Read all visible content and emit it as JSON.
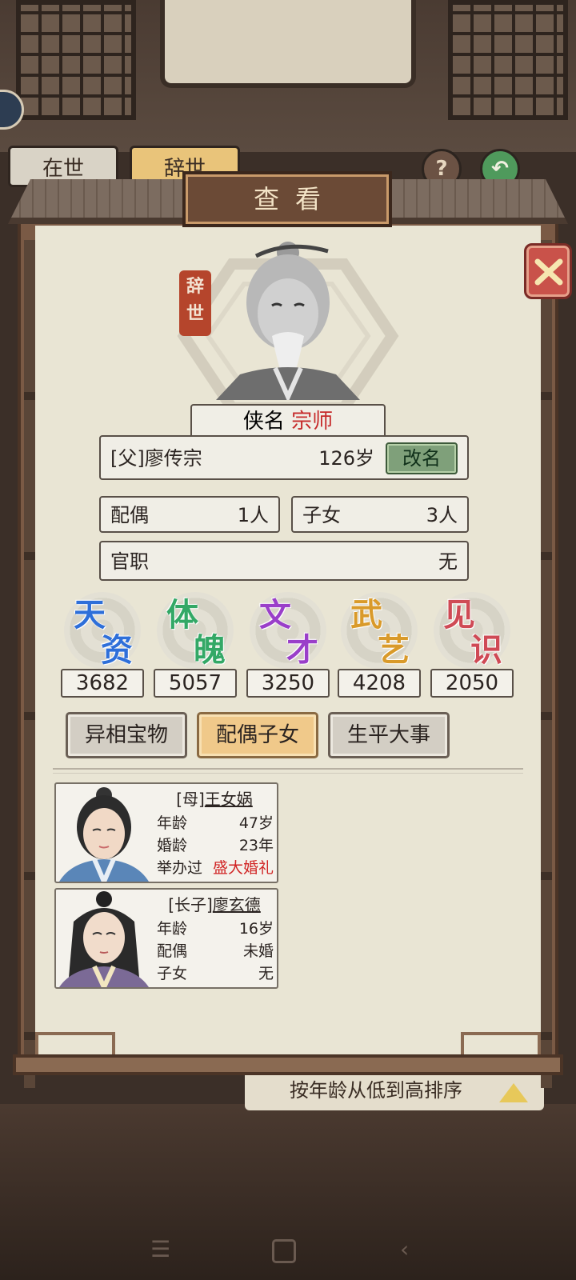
{
  "background": {
    "tabs": [
      "在世",
      "辞世"
    ],
    "sort_label": "按年龄从低到高排序"
  },
  "modal": {
    "title": "查看",
    "status_seal": [
      "辞",
      "世"
    ],
    "hero_title_label": "侠名",
    "hero_title_value": "宗师",
    "name": "[父]廖传宗",
    "age": "126岁",
    "rename_button": "改名",
    "spouse_label": "配偶",
    "spouse_value": "1人",
    "children_label": "子女",
    "children_value": "3人",
    "office_label": "官职",
    "office_value": "无",
    "stats": [
      {
        "c1": "天",
        "c2": "资",
        "value": "3682",
        "color": "#2e6fd9"
      },
      {
        "c1": "体",
        "c2": "魄",
        "value": "5057",
        "color": "#33a866"
      },
      {
        "c1": "文",
        "c2": "才",
        "value": "3250",
        "color": "#9a3fc9"
      },
      {
        "c1": "武",
        "c2": "艺",
        "value": "4208",
        "color": "#d99a2a"
      },
      {
        "c1": "见",
        "c2": "识",
        "value": "2050",
        "color": "#cf4a55"
      }
    ],
    "tabs": [
      "异相宝物",
      "配偶子女",
      "生平大事"
    ],
    "active_tab": "配偶子女",
    "family": [
      {
        "tag": "[母]",
        "name": "王女娲",
        "rows": [
          {
            "k": "年龄",
            "v": "47岁"
          },
          {
            "k": "婚龄",
            "v": "23年"
          },
          {
            "k": "举办过",
            "v": "盛大婚礼",
            "red": true
          }
        ]
      },
      {
        "tag": "[长子]",
        "name": "廖玄德",
        "rows": [
          {
            "k": "年龄",
            "v": "16岁"
          },
          {
            "k": "配偶",
            "v": "未婚"
          },
          {
            "k": "子女",
            "v": "无"
          }
        ]
      }
    ]
  },
  "nav": {
    "menu_icon": "menu-icon",
    "home_icon": "home-icon",
    "back_icon": "back-icon"
  }
}
